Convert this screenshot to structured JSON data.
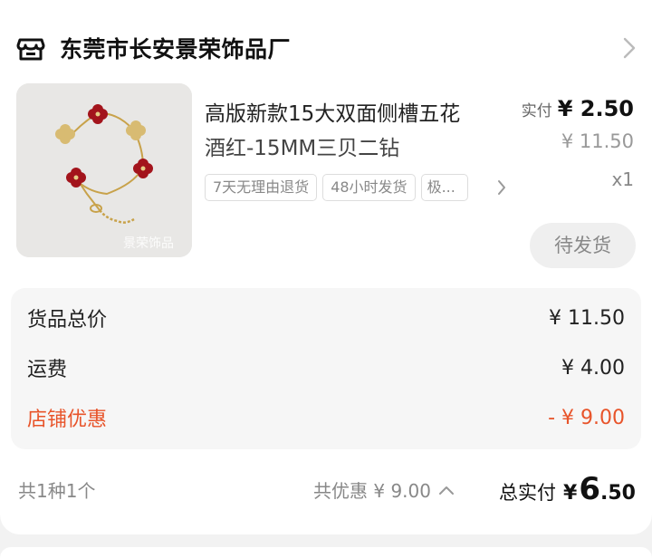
{
  "shop": {
    "name": "东莞市长安景荣饰品厂",
    "icon": "store-icon",
    "chevron": "chevron-right-icon"
  },
  "product": {
    "title_line1": "高版新款15大双面侧槽五花",
    "title_line2": "酒红-15MM三贝二钻",
    "image_watermark": "景荣饰品",
    "paid_label": "实付",
    "paid_price": "¥ 2.50",
    "original_price": "¥ 11.50",
    "quantity": "x1",
    "tags": [
      "7天无理由退货",
      "48小时发货",
      "极..."
    ],
    "status_button": "待发货"
  },
  "summary": {
    "goods_total_label": "货品总价",
    "goods_total_value": "¥ 11.50",
    "shipping_label": "运费",
    "shipping_value": "¥ 4.00",
    "shop_discount_label": "店铺优惠",
    "shop_discount_value": "- ¥ 9.00"
  },
  "footer": {
    "item_count": "共1种1个",
    "total_discount": "共优惠 ¥ 9.00",
    "total_label": "总实付",
    "total_symbol": "¥",
    "total_integer": "6",
    "total_decimal": ".50"
  },
  "colors": {
    "accent_discount": "#e8542a",
    "text_primary": "#222222",
    "text_muted": "#888888"
  }
}
